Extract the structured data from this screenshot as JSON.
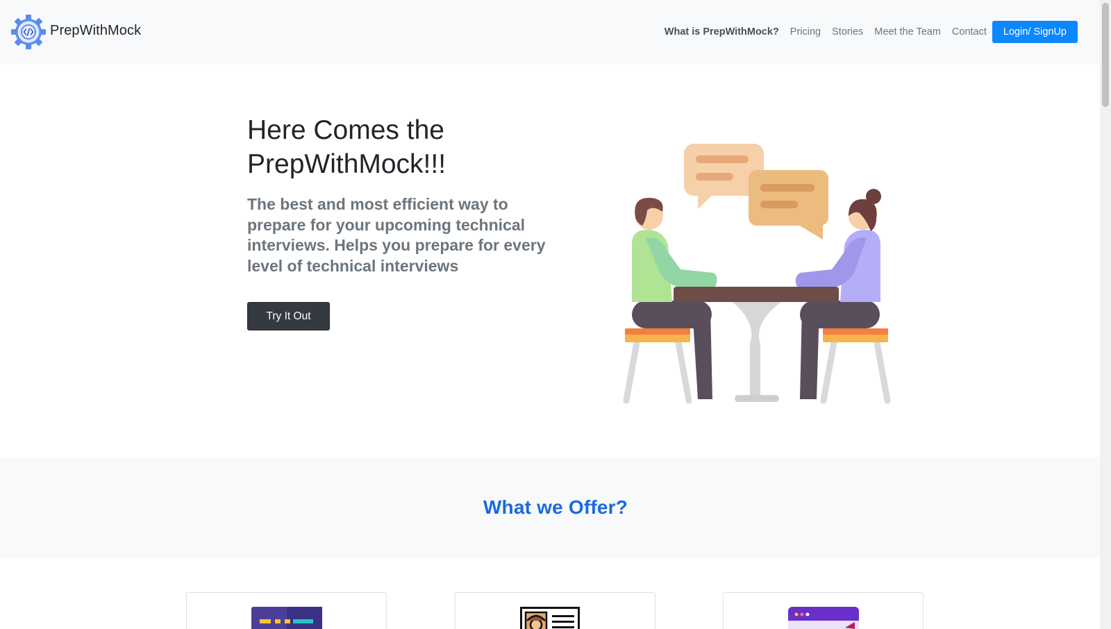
{
  "brand": {
    "name": "PrepWithMock",
    "logo_icon": "code-gear-icon"
  },
  "nav": {
    "items": [
      {
        "label": "What is PrepWithMock?",
        "active": true
      },
      {
        "label": "Pricing",
        "active": false
      },
      {
        "label": "Stories",
        "active": false
      },
      {
        "label": "Meet the Team",
        "active": false
      },
      {
        "label": "Contact",
        "active": false
      }
    ],
    "login_label": "Login/ SignUp"
  },
  "hero": {
    "title_line1": "Here Comes the",
    "title_line2": "PrepWithMock!!!",
    "subtitle": "The best and most efficient way to prepare for your upcoming technical interviews. Helps you prepare for every level of technical interviews",
    "cta_label": "Try It Out",
    "illustration": "mock-interview-illustration"
  },
  "offer": {
    "title": "What we Offer?"
  },
  "cards": [
    {
      "icon": "code-editor-icon"
    },
    {
      "icon": "resume-profile-icon"
    },
    {
      "icon": "browser-window-icon"
    }
  ],
  "colors": {
    "primary": "#0d87fd",
    "dark_button": "#343a40",
    "offer_title": "#1a6ae0",
    "navbar_bg": "#f8f9fa"
  }
}
